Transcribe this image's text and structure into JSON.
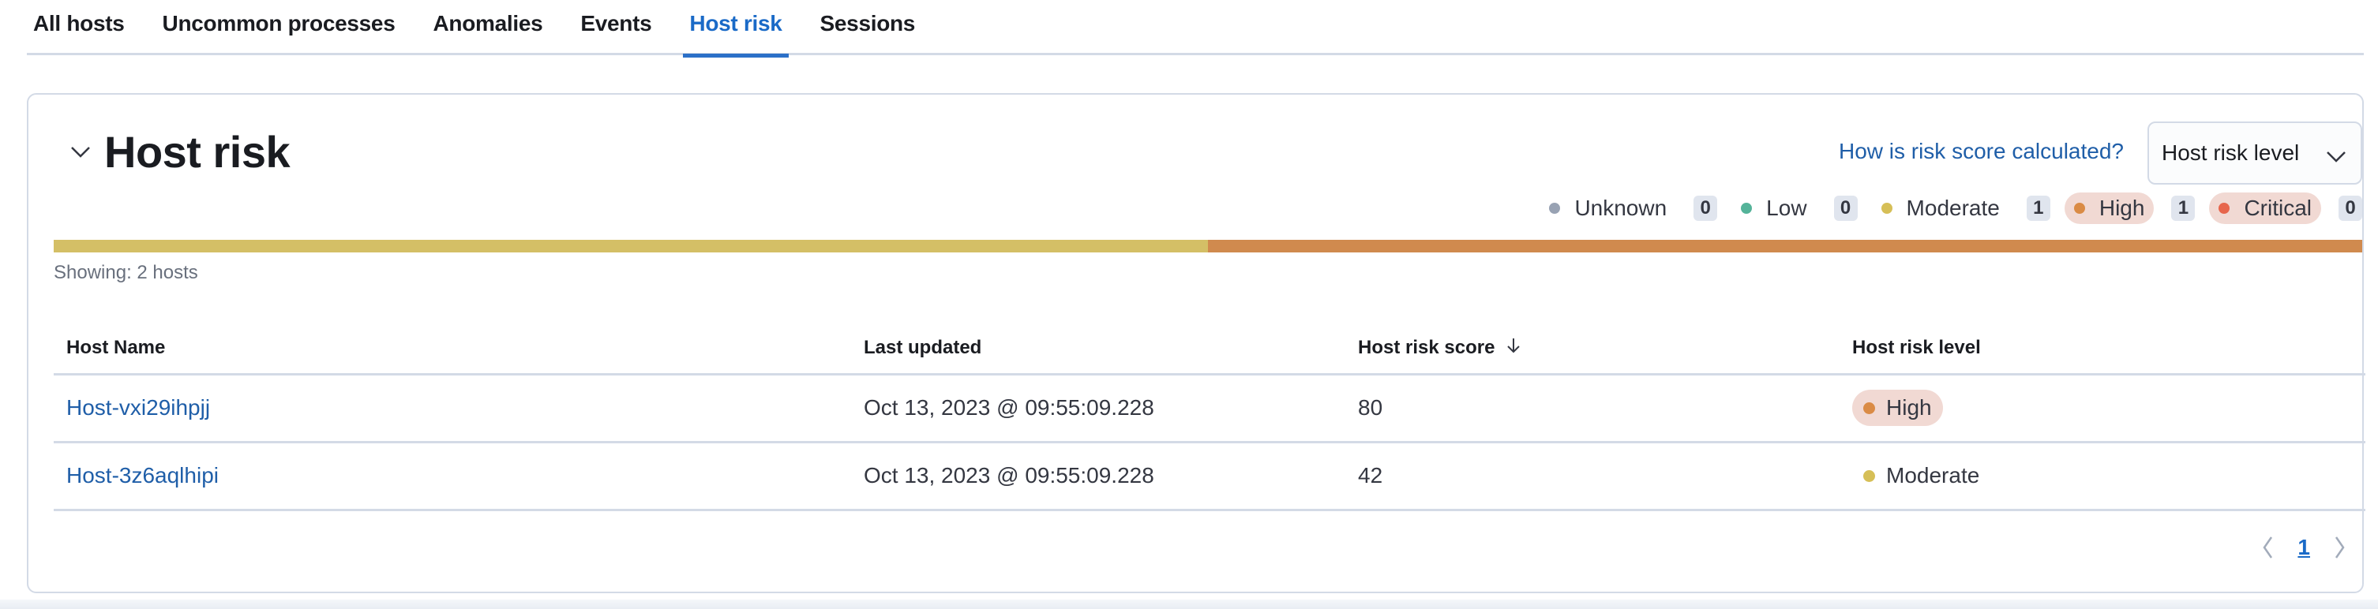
{
  "tabs": [
    {
      "label": "All hosts",
      "active": false
    },
    {
      "label": "Uncommon processes",
      "active": false
    },
    {
      "label": "Anomalies",
      "active": false
    },
    {
      "label": "Events",
      "active": false
    },
    {
      "label": "Host risk",
      "active": true
    },
    {
      "label": "Sessions",
      "active": false
    }
  ],
  "panel": {
    "title": "Host risk",
    "help_link": "How is risk score calculated?",
    "dropdown": {
      "selected": "Host risk level"
    },
    "showing": "Showing: 2 hosts"
  },
  "legend": [
    {
      "label": "Unknown",
      "count": "0",
      "color": "#98a2b3",
      "highlighted": false
    },
    {
      "label": "Low",
      "count": "0",
      "color": "#54b399",
      "highlighted": false
    },
    {
      "label": "Moderate",
      "count": "1",
      "color": "#d6bf57",
      "highlighted": false
    },
    {
      "label": "High",
      "count": "1",
      "color": "#da8b45",
      "highlighted": true
    },
    {
      "label": "Critical",
      "count": "0",
      "color": "#e7664c",
      "highlighted": true
    }
  ],
  "distribution": [
    {
      "level": "Moderate",
      "fraction": 0.5,
      "color": "#d4bf66"
    },
    {
      "level": "High",
      "fraction": 0.5,
      "color": "#d08a4e"
    }
  ],
  "table": {
    "columns": [
      "Host Name",
      "Last updated",
      "Host risk score",
      "Host risk level"
    ],
    "sort_column": "Host risk score",
    "sort_direction": "descending",
    "rows": [
      {
        "host": "Host-vxi29ihpjj",
        "updated": "Oct 13, 2023 @ 09:55:09.228",
        "score": "80",
        "level": "High",
        "level_color": "#da8b45",
        "highlighted": true
      },
      {
        "host": "Host-3z6aqlhipi",
        "updated": "Oct 13, 2023 @ 09:55:09.228",
        "score": "42",
        "level": "Moderate",
        "level_color": "#d6bf57",
        "highlighted": false
      }
    ]
  },
  "pagination": {
    "current_page": "1"
  }
}
